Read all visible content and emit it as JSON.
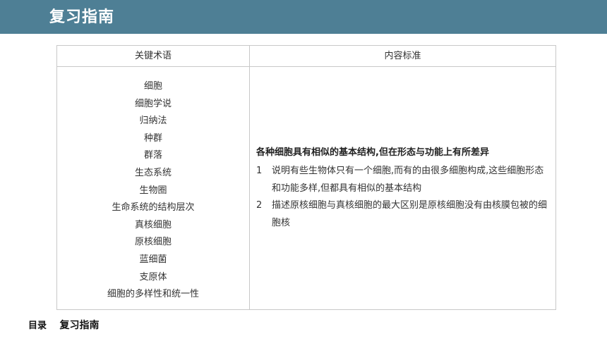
{
  "header": {
    "title": "复习指南"
  },
  "table": {
    "col_headers": [
      "关键术语",
      "内容标准"
    ],
    "terms": [
      "细胞",
      "细胞学说",
      "归纳法",
      "种群",
      "群落",
      "生态系统",
      "生物圈",
      "生命系统的结构层次",
      "真核细胞",
      "原核细胞",
      "蓝细菌",
      "支原体",
      "细胞的多样性和统一性"
    ],
    "content": {
      "heading": "各种细胞具有相似的基本结构,但在形态与功能上有所差异",
      "items": [
        {
          "num": "1",
          "text": "说明有些生物体只有一个细胞,而有的由很多细胞构成,这些细胞形态和功能多样,但都具有相似的基本结构"
        },
        {
          "num": "2",
          "text": "描述原核细胞与真核细胞的最大区别是原核细胞没有由核膜包被的细胞核"
        }
      ]
    }
  },
  "footer": {
    "label": "目录",
    "title": "复习指南"
  },
  "colors": {
    "header_bg": "#4e7f95",
    "border": "#c8c8c8"
  }
}
